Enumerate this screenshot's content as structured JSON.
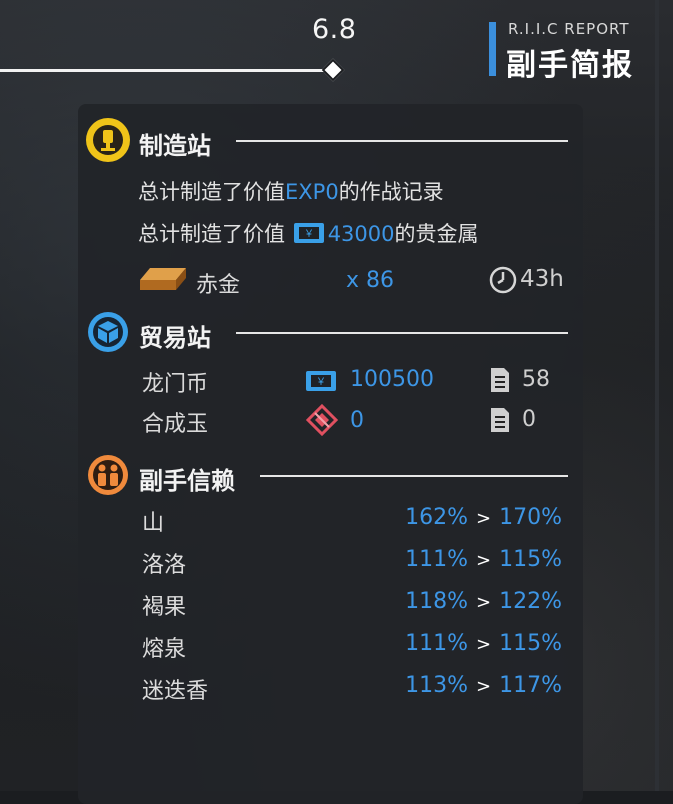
{
  "slider": {
    "value_label": "6.8",
    "position_fraction": 0.5
  },
  "report": {
    "subtitle": "R.I.I.C REPORT",
    "title": "副手简报"
  },
  "manufacturing": {
    "title": "制造站",
    "line1_prefix": "总计制造了价值",
    "line1_value": "EXP0",
    "line1_suffix": "的作战记录",
    "line2_prefix": "总计制造了价值",
    "line2_value": "43000",
    "line2_suffix": "的贵金属",
    "product_name": "赤金",
    "product_count": "x 86",
    "product_time": "43h"
  },
  "trading": {
    "title": "贸易站",
    "rows": [
      {
        "name": "龙门币",
        "value": "100500",
        "orders": "58",
        "icon": "lmd-icon"
      },
      {
        "name": "合成玉",
        "value": "0",
        "orders": "0",
        "icon": "orundum-icon"
      }
    ]
  },
  "trust": {
    "title": "副手信赖",
    "arrow": ">",
    "rows": [
      {
        "name": "山",
        "from": "162%",
        "to": "170%"
      },
      {
        "name": "洛洛",
        "from": "111%",
        "to": "115%"
      },
      {
        "name": "褐果",
        "from": "118%",
        "to": "122%"
      },
      {
        "name": "熔泉",
        "from": "111%",
        "to": "115%"
      },
      {
        "name": "迷迭香",
        "from": "113%",
        "to": "117%"
      }
    ]
  },
  "colors": {
    "accent_blue": "#3d96e6",
    "manufacture_yellow": "#f0c419",
    "trade_blue": "#3aa0e8",
    "trust_orange": "#f08a3c"
  }
}
